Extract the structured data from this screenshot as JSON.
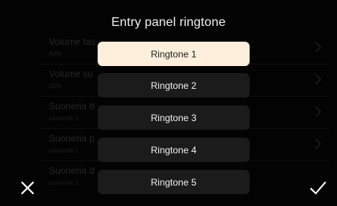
{
  "background_list": {
    "rows": [
      {
        "title": "Volume tas",
        "value": "40%"
      },
      {
        "title": "Volume su",
        "value": "20%"
      },
      {
        "title": "Suoneria d",
        "value": "suoneria 1"
      },
      {
        "title": "Suoneria p",
        "value": "suoneria 1"
      },
      {
        "title": "Suoneria d",
        "value": "suoneria 1"
      }
    ]
  },
  "dialog": {
    "title": "Entry panel ringtone",
    "options": [
      {
        "label": "Ringtone 1",
        "selected": true
      },
      {
        "label": "Ringtone 2",
        "selected": false
      },
      {
        "label": "Ringtone 3",
        "selected": false
      },
      {
        "label": "Ringtone 4",
        "selected": false
      },
      {
        "label": "Ringtone 5",
        "selected": false
      }
    ]
  },
  "icons": {
    "close": "close-icon",
    "confirm": "checkmark-icon",
    "row_chevron": "chevron-right-icon"
  },
  "colors": {
    "background": "#060606",
    "option_bg": "#1b1b1b",
    "option_selected_bg": "#fdefdb",
    "text": "#f0f0f0"
  }
}
